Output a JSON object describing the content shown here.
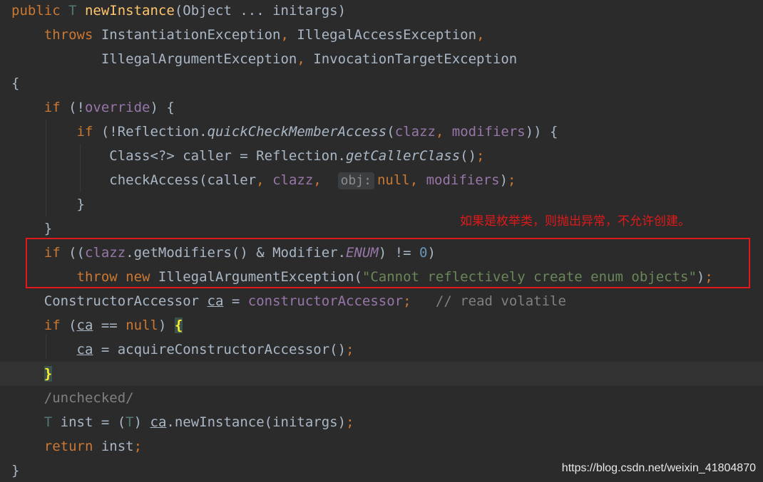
{
  "code_lines": [
    {
      "current": false,
      "tokens": [
        {
          "t": "public ",
          "c": "kw"
        },
        {
          "t": "T ",
          "c": "tp"
        },
        {
          "t": "newInstance",
          "c": "fn"
        },
        {
          "t": "(Object ... initargs)",
          "c": "pl"
        }
      ]
    },
    {
      "current": false,
      "tokens": [
        {
          "t": "    throws ",
          "c": "kw"
        },
        {
          "t": "InstantiationException",
          "c": "pl"
        },
        {
          "t": ", ",
          "c": "kw"
        },
        {
          "t": "IllegalAccessException",
          "c": "pl"
        },
        {
          "t": ",",
          "c": "kw"
        }
      ]
    },
    {
      "current": false,
      "tokens": [
        {
          "t": "           IllegalArgumentException",
          "c": "pl"
        },
        {
          "t": ", ",
          "c": "kw"
        },
        {
          "t": "InvocationTargetException",
          "c": "pl"
        }
      ]
    },
    {
      "current": false,
      "tokens": [
        {
          "t": "{",
          "c": "pl"
        }
      ]
    },
    {
      "current": false,
      "tokens": [
        {
          "t": "    if ",
          "c": "kw"
        },
        {
          "t": "(!",
          "c": "pl"
        },
        {
          "t": "override",
          "c": "fd"
        },
        {
          "t": ") {",
          "c": "pl"
        }
      ]
    },
    {
      "current": false,
      "tokens": [
        {
          "t": "        if ",
          "c": "kw"
        },
        {
          "t": "(!Reflection.",
          "c": "pl"
        },
        {
          "t": "quickCheckMemberAccess",
          "c": "pl it"
        },
        {
          "t": "(",
          "c": "pl"
        },
        {
          "t": "clazz",
          "c": "fd"
        },
        {
          "t": ", ",
          "c": "kw"
        },
        {
          "t": "modifiers",
          "c": "fd"
        },
        {
          "t": ")) {",
          "c": "pl"
        }
      ]
    },
    {
      "current": false,
      "tokens": [
        {
          "t": "            Class<?> caller = Reflection.",
          "c": "pl"
        },
        {
          "t": "getCallerClass",
          "c": "pl it"
        },
        {
          "t": "()",
          "c": "pl"
        },
        {
          "t": ";",
          "c": "kw"
        }
      ]
    },
    {
      "current": false,
      "tokens": [
        {
          "t": "            checkAccess(caller",
          "c": "pl"
        },
        {
          "t": ", ",
          "c": "kw"
        },
        {
          "t": "clazz",
          "c": "fd"
        },
        {
          "t": ",  ",
          "c": "kw"
        },
        {
          "t": "obj:",
          "c": "hint"
        },
        {
          "t": "null",
          "c": "kw"
        },
        {
          "t": ", ",
          "c": "kw"
        },
        {
          "t": "modifiers",
          "c": "fd"
        },
        {
          "t": ")",
          "c": "pl"
        },
        {
          "t": ";",
          "c": "kw"
        }
      ]
    },
    {
      "current": false,
      "tokens": [
        {
          "t": "        }",
          "c": "pl"
        }
      ]
    },
    {
      "current": false,
      "tokens": [
        {
          "t": "    }",
          "c": "pl"
        }
      ]
    },
    {
      "current": false,
      "tokens": [
        {
          "t": "    if ",
          "c": "kw"
        },
        {
          "t": "((",
          "c": "pl"
        },
        {
          "t": "clazz",
          "c": "fd"
        },
        {
          "t": ".getModifiers() & Modifier.",
          "c": "pl"
        },
        {
          "t": "ENUM",
          "c": "fi"
        },
        {
          "t": ") != ",
          "c": "pl"
        },
        {
          "t": "0",
          "c": "num"
        },
        {
          "t": ")",
          "c": "pl"
        }
      ]
    },
    {
      "current": false,
      "tokens": [
        {
          "t": "        throw new ",
          "c": "kw"
        },
        {
          "t": "IllegalArgumentException(",
          "c": "pl"
        },
        {
          "t": "\"Cannot reflectively create enum objects\"",
          "c": "str"
        },
        {
          "t": ")",
          "c": "pl"
        },
        {
          "t": ";",
          "c": "kw"
        }
      ]
    },
    {
      "current": false,
      "tokens": [
        {
          "t": "    ConstructorAccessor ",
          "c": "pl"
        },
        {
          "t": "ca",
          "c": "pl ul"
        },
        {
          "t": " = ",
          "c": "pl"
        },
        {
          "t": "constructorAccessor",
          "c": "fd"
        },
        {
          "t": ";   ",
          "c": "kw"
        },
        {
          "t": "// read volatile",
          "c": "cm"
        }
      ]
    },
    {
      "current": false,
      "tokens": [
        {
          "t": "    if ",
          "c": "kw"
        },
        {
          "t": "(",
          "c": "pl"
        },
        {
          "t": "ca",
          "c": "pl ul"
        },
        {
          "t": " == ",
          "c": "pl"
        },
        {
          "t": "null",
          "c": "kw"
        },
        {
          "t": ") ",
          "c": "pl"
        },
        {
          "t": "{",
          "c": "brace-match"
        }
      ]
    },
    {
      "current": false,
      "tokens": [
        {
          "t": "        ",
          "c": "pl"
        },
        {
          "t": "ca",
          "c": "pl ul"
        },
        {
          "t": " = acquireConstructorAccessor()",
          "c": "pl"
        },
        {
          "t": ";",
          "c": "kw"
        }
      ]
    },
    {
      "current": true,
      "tokens": [
        {
          "t": "    ",
          "c": "pl"
        },
        {
          "t": "}",
          "c": "brace-match"
        }
      ]
    },
    {
      "current": false,
      "tokens": [
        {
          "t": "    /unchecked/",
          "c": "cm"
        }
      ]
    },
    {
      "current": false,
      "tokens": [
        {
          "t": "    ",
          "c": "pl"
        },
        {
          "t": "T",
          "c": "tp"
        },
        {
          "t": " inst = (",
          "c": "pl"
        },
        {
          "t": "T",
          "c": "tp"
        },
        {
          "t": ") ",
          "c": "pl"
        },
        {
          "t": "ca",
          "c": "pl ul"
        },
        {
          "t": ".newInstance(initargs)",
          "c": "pl"
        },
        {
          "t": ";",
          "c": "kw"
        }
      ]
    },
    {
      "current": false,
      "tokens": [
        {
          "t": "    return ",
          "c": "kw"
        },
        {
          "t": "inst",
          "c": "pl"
        },
        {
          "t": ";",
          "c": "kw"
        }
      ]
    },
    {
      "current": false,
      "tokens": [
        {
          "t": "}",
          "c": "pl"
        }
      ]
    }
  ],
  "annotation": {
    "text": "如果是枚举类，则抛出异常，不允许创建。",
    "color": "#e0191b"
  },
  "watermark": {
    "text": "https://blog.csdn.net/weixin_41804870"
  },
  "theme": {
    "background": "#2b2b2b",
    "keyword": "#cc7832",
    "method": "#ffc66d",
    "field": "#9876aa",
    "string": "#6a8759",
    "number": "#6897bb",
    "comment": "#808080",
    "default": "#a9b7c6"
  }
}
